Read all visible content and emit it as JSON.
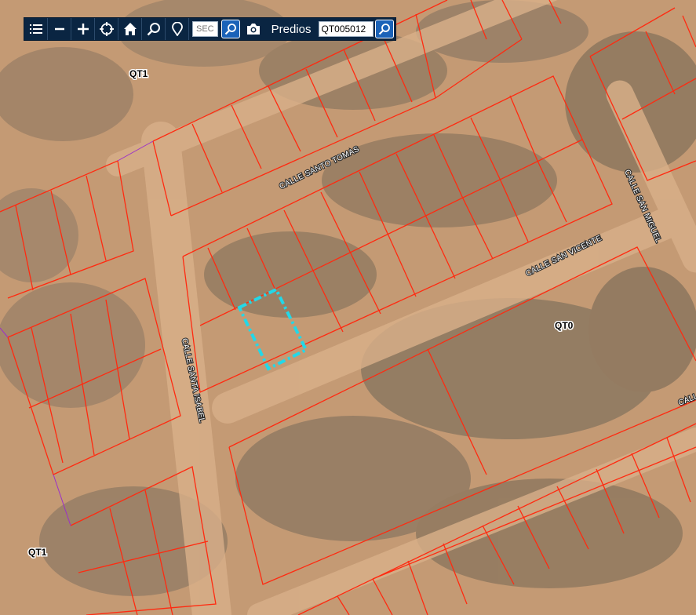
{
  "toolbar": {
    "icons": [
      "menu-icon",
      "zoom-out-icon",
      "zoom-in-icon",
      "locate-icon",
      "home-icon",
      "search-icon",
      "pin-icon"
    ],
    "sec_label": "SEC",
    "predios_label": "Predios",
    "predio_input_value": "QT005012"
  },
  "map": {
    "streets": [
      "CALLE SANTO TOMAS",
      "CALLE SAN VICENTE",
      "CALLE SAN MIGUEL",
      "CALLE SANTA ISABEL",
      "CALL"
    ],
    "zones": [
      "QT1",
      "QT0",
      "QT1"
    ],
    "colors": {
      "parcel_line": "#ff2a10",
      "selected_parcel": "#22d8e8",
      "boundary": "#9b30c8",
      "toolbar": "#0a2542",
      "button_blue": "#1a62b8"
    }
  }
}
